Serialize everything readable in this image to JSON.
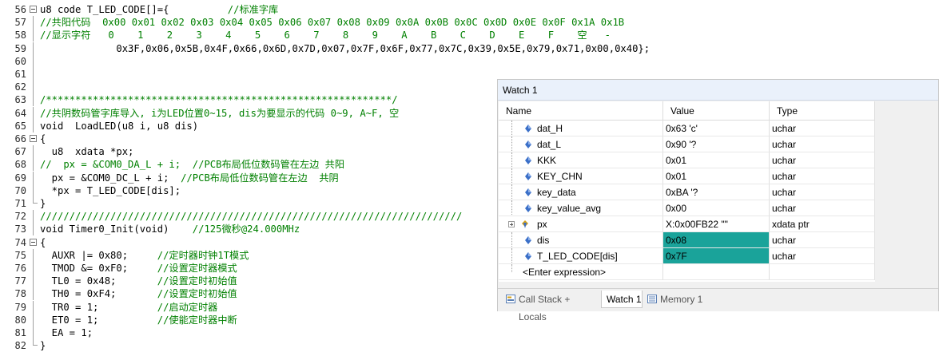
{
  "editor": {
    "lines": [
      {
        "n": "56",
        "code": "u8 code T_LED_CODE[]={",
        "comment": "          //标准字库",
        "fold": true
      },
      {
        "n": "57",
        "comment": "//共阳代码  0x00 0x01 0x02 0x03 0x04 0x05 0x06 0x07 0x08 0x09 0x0A 0x0B 0x0C 0x0D 0x0E 0x0F 0x1A 0x1B"
      },
      {
        "n": "58",
        "comment": "//显示字符   0    1    2    3    4    5    6    7    8    9    A    B    C    D    E    F    空   -"
      },
      {
        "n": "59",
        "code": "             0x3F,0x06,0x5B,0x4F,0x66,0x6D,0x7D,0x07,0x7F,0x6F,0x77,0x7C,0x39,0x5E,0x79,0x71,0x00,0x40};"
      },
      {
        "n": "60",
        "code": ""
      },
      {
        "n": "61",
        "code": ""
      },
      {
        "n": "62",
        "code": ""
      },
      {
        "n": "63",
        "comment": "/***********************************************************/"
      },
      {
        "n": "64",
        "comment": "//共阴数码管字库导入, i为LED位置0~15, dis为要显示的代码 0~9, A~F, 空"
      },
      {
        "n": "65",
        "code": "void  LoadLED(u8 i, u8 dis)"
      },
      {
        "n": "66",
        "code": "{",
        "fold": true
      },
      {
        "n": "67",
        "code": "  u8  xdata *px;"
      },
      {
        "n": "68",
        "comment": "//  px = &COM0_DA_L + i;  //PCB布局低位数码管在左边 共阳"
      },
      {
        "n": "69",
        "code": "  px = &COM0_DC_L + i;",
        "comment": "  //PCB布局低位数码管在左边  共阴"
      },
      {
        "n": "70",
        "code": "  *px = T_LED_CODE[dis];"
      },
      {
        "n": "71",
        "code": "}"
      },
      {
        "n": "72",
        "comment": "////////////////////////////////////////////////////////////////////////"
      },
      {
        "n": "73",
        "code": "void Timer0_Init(void)",
        "comment": "    //125微秒@24.000MHz"
      },
      {
        "n": "74",
        "code": "{",
        "fold": true
      },
      {
        "n": "75",
        "code": "  AUXR |= 0x80;",
        "comment": "     //定时器时钟1T模式"
      },
      {
        "n": "76",
        "code": "  TMOD &= 0xF0;",
        "comment": "     //设置定时器模式"
      },
      {
        "n": "77",
        "code": "  TL0 = 0x48;",
        "comment": "       //设置定时初始值"
      },
      {
        "n": "78",
        "code": "  TH0 = 0xF4;",
        "comment": "       //设置定时初始值"
      },
      {
        "n": "79",
        "code": "  TR0 = 1;",
        "comment": "          //启动定时器"
      },
      {
        "n": "80",
        "code": "  ET0 = 1;",
        "comment": "          //使能定时器中断"
      },
      {
        "n": "81",
        "code": "  EA = 1;"
      },
      {
        "n": "82",
        "code": "}"
      }
    ]
  },
  "watch": {
    "title": "Watch 1",
    "headers": {
      "name": "Name",
      "value": "Value",
      "type": "Type"
    },
    "rows": [
      {
        "name": "dat_H",
        "value": "0x63 'c'",
        "type": "uchar"
      },
      {
        "name": "dat_L",
        "value": "0x90 '?",
        "type": "uchar"
      },
      {
        "name": "KKK",
        "value": "0x01",
        "type": "uchar"
      },
      {
        "name": "KEY_CHN",
        "value": "0x01",
        "type": "uchar"
      },
      {
        "name": "key_data",
        "value": "0xBA '?",
        "type": "uchar"
      },
      {
        "name": "key_value_avg",
        "value": "0x00",
        "type": "uchar"
      },
      {
        "name": "px",
        "value": "X:0x00FB22 \"\"",
        "type": "xdata ptr",
        "expandable": true
      },
      {
        "name": "dis",
        "value": "0x08",
        "type": "uchar",
        "highlight": true
      },
      {
        "name": "T_LED_CODE[dis]",
        "value": "0x7F",
        "type": "uchar",
        "highlight": true
      }
    ],
    "enter_expression": "<Enter expression>",
    "tabs": [
      {
        "label": "Call Stack + Locals",
        "icon": "call-stack-icon"
      },
      {
        "label": "Watch 1",
        "icon": "",
        "active": true
      },
      {
        "label": "Memory 1",
        "icon": "memory-icon"
      }
    ],
    "colors": {
      "highlight": "#1aa39a",
      "title_bg": "#eaf1fb"
    }
  }
}
